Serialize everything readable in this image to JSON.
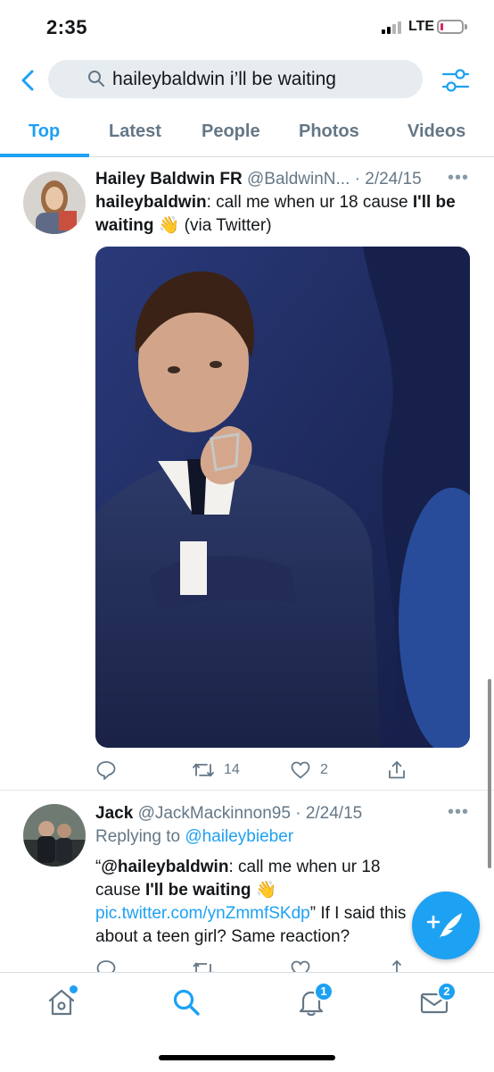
{
  "status_bar": {
    "time": "2:35",
    "network": "LTE",
    "battery_level": 0.12,
    "battery_color": "#e0245e"
  },
  "search": {
    "query": "haileybaldwin i’ll be waiting"
  },
  "tabs": [
    {
      "label": "Top",
      "active": true
    },
    {
      "label": "Latest",
      "active": false
    },
    {
      "label": "People",
      "active": false
    },
    {
      "label": "Photos",
      "active": false
    },
    {
      "label": "Videos",
      "active": false
    }
  ],
  "tweets": [
    {
      "name": "Hailey Baldwin FR",
      "handle": "@BaldwinN...",
      "date": "· 2/24/15",
      "text_parts": {
        "prefix_bold": "haileybaldwin",
        "middle": ": call me when ur 18 cause ",
        "bold": "I'll be waiting",
        "emoji": "👋",
        "suffix": " (via Twitter)"
      },
      "stats": {
        "replies": "",
        "retweets": "14",
        "likes": "2"
      }
    },
    {
      "name": "Jack",
      "handle": "@JackMackinnon95",
      "date": "· 2/24/15",
      "replying_label": "Replying to ",
      "replying_to": "@haileybieber",
      "text_parts": {
        "open_quote": "“",
        "bold_handle": "@haileybaldwin",
        "middle": ": call me when ur 18 cause ",
        "bold": "I'll be waiting",
        "emoji": "👋",
        "link": "pic.twitter.com/ynZmmfSKdp",
        "suffix": "” If I said this about a teen girl? Same reaction?"
      }
    }
  ],
  "bottom_nav": {
    "notifications_badge": "1",
    "messages_badge": "2"
  },
  "colors": {
    "accent": "#1da1f2",
    "secondary_text": "#657786",
    "primary_text": "#14171a"
  }
}
